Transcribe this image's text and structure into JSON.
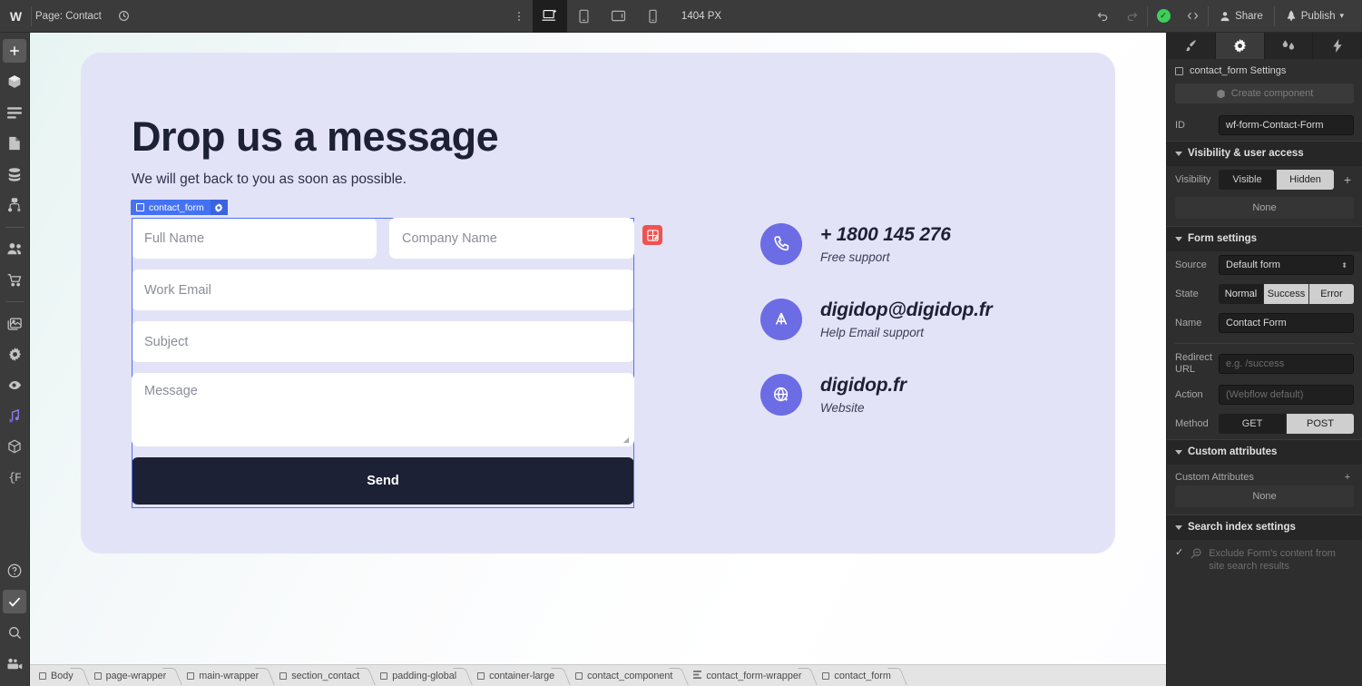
{
  "topbar": {
    "logo": "W",
    "page_label": "Page: Contact",
    "history_icon": "history-icon",
    "menu_icon": "kebab-menu-icon",
    "breakpoints": [
      {
        "name": "desktop",
        "icon": "desktop-icon",
        "active": true
      },
      {
        "name": "tablet",
        "icon": "tablet-icon",
        "active": false
      },
      {
        "name": "tablet-landscape",
        "icon": "tablet-landscape-icon",
        "active": false
      },
      {
        "name": "mobile",
        "icon": "mobile-icon",
        "active": false
      }
    ],
    "viewport_width": "1404 PX",
    "undo_icon": "undo-icon",
    "redo_icon": "redo-icon",
    "status_icon": "check-circle-icon",
    "code_icon": "code-brackets-icon",
    "share_label": "Share",
    "publish_label": "Publish"
  },
  "leftrail": {
    "items": [
      {
        "name": "add-elements",
        "icon": "plus-icon",
        "selected": true
      },
      {
        "name": "components",
        "icon": "cube-icon",
        "selected": false
      },
      {
        "name": "navigator",
        "icon": "layers-icon",
        "selected": false
      },
      {
        "name": "pages",
        "icon": "page-icon",
        "selected": false
      },
      {
        "name": "cms",
        "icon": "database-icon",
        "selected": false
      },
      {
        "name": "logic",
        "icon": "logic-flow-icon",
        "selected": false
      },
      {
        "name": "users",
        "icon": "users-icon",
        "selected": false
      },
      {
        "name": "ecommerce",
        "icon": "cart-icon",
        "selected": false
      },
      {
        "name": "assets",
        "icon": "image-icon",
        "selected": false
      },
      {
        "name": "settings",
        "icon": "gear-icon",
        "selected": false
      },
      {
        "name": "audit",
        "icon": "audit-icon",
        "selected": false
      },
      {
        "name": "ai-assistant",
        "icon": "ai-sparkle-icon",
        "selected": false
      },
      {
        "name": "apps",
        "icon": "package-icon",
        "selected": false
      },
      {
        "name": "variables",
        "icon": "variables-icon",
        "selected": false
      }
    ],
    "bottom_items": [
      {
        "name": "help",
        "icon": "question-circle-icon",
        "selected": false
      },
      {
        "name": "accessibility-check",
        "icon": "checkmark-icon",
        "selected": true
      },
      {
        "name": "search",
        "icon": "search-icon",
        "selected": false
      },
      {
        "name": "video-tutorials",
        "icon": "video-icon",
        "selected": false
      }
    ]
  },
  "canvas": {
    "hero": {
      "title": "Drop us a message",
      "subtitle": "We will get back to you as soon as possible."
    },
    "selection_tag": {
      "label": "contact_form",
      "box_icon": "element-box-icon",
      "gear_icon": "gear-icon"
    },
    "component_badge_icon": "component-edit-icon",
    "form": {
      "fields": [
        {
          "name": "full-name-field",
          "placeholder": "Full Name",
          "type": "half"
        },
        {
          "name": "company-name-field",
          "placeholder": "Company Name",
          "type": "half"
        },
        {
          "name": "work-email-field",
          "placeholder": "Work Email",
          "type": "full"
        },
        {
          "name": "subject-field",
          "placeholder": "Subject",
          "type": "full"
        }
      ],
      "message_placeholder": "Message",
      "submit_label": "Send"
    },
    "contact_info": [
      {
        "icon": "phone-icon",
        "value": "+ 1800 145 276",
        "caption": "Free support"
      },
      {
        "icon": "email-icon",
        "value": "digidop@digidop.fr",
        "caption": "Help Email support"
      },
      {
        "icon": "globe-icon",
        "value": "digidop.fr",
        "caption": "Website"
      }
    ]
  },
  "breadcrumb": [
    {
      "label": "Body",
      "icon": "body-icon"
    },
    {
      "label": "page-wrapper",
      "icon": "div-icon"
    },
    {
      "label": "main-wrapper",
      "icon": "div-icon"
    },
    {
      "label": "section_contact",
      "icon": "div-icon"
    },
    {
      "label": "padding-global",
      "icon": "div-icon"
    },
    {
      "label": "container-large",
      "icon": "div-icon"
    },
    {
      "label": "contact_component",
      "icon": "div-icon"
    },
    {
      "label": "contact_form-wrapper",
      "icon": "form-icon"
    },
    {
      "label": "contact_form",
      "icon": "div-icon"
    }
  ],
  "rightpanel": {
    "tabs": [
      {
        "name": "style",
        "icon": "paintbrush-icon",
        "active": false
      },
      {
        "name": "settings",
        "icon": "gear-icon",
        "active": true
      },
      {
        "name": "interactions",
        "icon": "droplets-icon",
        "active": false
      },
      {
        "name": "effects",
        "icon": "lightning-icon",
        "active": false
      }
    ],
    "header": "contact_form Settings",
    "create_component_label": "Create component",
    "create_component_icon": "component-icon",
    "id_label": "ID",
    "id_value": "wf-form-Contact-Form",
    "visibility_section": "Visibility & user access",
    "visibility_label": "Visibility",
    "visibility_options": [
      "Visible",
      "Hidden"
    ],
    "visibility_selected": "Hidden",
    "visibility_none": "None",
    "form_section": "Form settings",
    "source_label": "Source",
    "source_value": "Default form",
    "state_label": "State",
    "state_options": [
      "Normal",
      "Success",
      "Error"
    ],
    "state_selected": "Normal",
    "name_label": "Name",
    "name_value": "Contact Form",
    "redirect_label": "Redirect URL",
    "redirect_placeholder": "e.g. /success",
    "action_label": "Action",
    "action_placeholder": "(Webflow default)",
    "method_label": "Method",
    "method_options": [
      "GET",
      "POST"
    ],
    "method_selected": "POST",
    "custom_attr_section": "Custom attributes",
    "custom_attr_label": "Custom Attributes",
    "custom_attr_none": "None",
    "search_section": "Search index settings",
    "search_exclude_label": "Exclude Form's content from site search results",
    "search_icon": "search-minus-icon",
    "search_checked_icon": "checkmark-icon"
  }
}
